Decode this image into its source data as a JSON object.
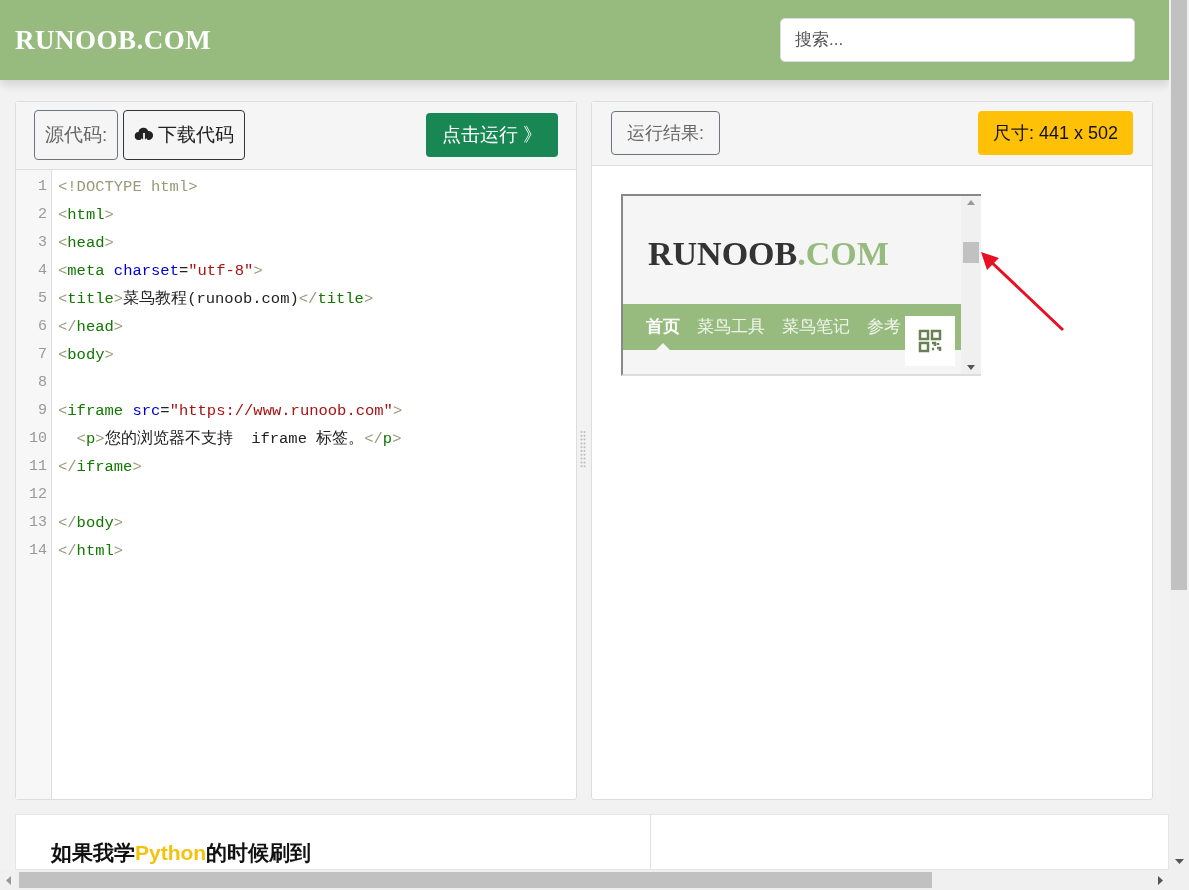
{
  "header": {
    "logo": "RUNOOB.COM",
    "search": {
      "placeholder": "搜索..."
    }
  },
  "editor_panel": {
    "label": "源代码:",
    "download_button": "下载代码",
    "run_button": "点击运行 》",
    "lines": [
      {
        "number": "1",
        "segments": [
          {
            "kind": "bracket",
            "text": "<!DOCTYPE html"
          },
          {
            "kind": "bracket",
            "text": ">"
          }
        ]
      },
      {
        "number": "2",
        "segments": [
          {
            "kind": "bracket",
            "text": "<"
          },
          {
            "kind": "tag",
            "text": "html"
          },
          {
            "kind": "bracket",
            "text": ">"
          }
        ]
      },
      {
        "number": "3",
        "segments": [
          {
            "kind": "bracket",
            "text": "<"
          },
          {
            "kind": "tag",
            "text": "head"
          },
          {
            "kind": "bracket",
            "text": ">"
          }
        ]
      },
      {
        "number": "4",
        "segments": [
          {
            "kind": "bracket",
            "text": "<"
          },
          {
            "kind": "tag",
            "text": "meta"
          },
          {
            "kind": "attr",
            "text": " charset"
          },
          {
            "kind": "plain",
            "text": "="
          },
          {
            "kind": "string",
            "text": "\"utf-8\""
          },
          {
            "kind": "bracket",
            "text": ">"
          }
        ]
      },
      {
        "number": "5",
        "segments": [
          {
            "kind": "bracket",
            "text": "<"
          },
          {
            "kind": "tag",
            "text": "title"
          },
          {
            "kind": "bracket",
            "text": ">"
          },
          {
            "kind": "plain",
            "text": "菜鸟教程(runoob.com)"
          },
          {
            "kind": "bracket",
            "text": "</"
          },
          {
            "kind": "tag",
            "text": "title"
          },
          {
            "kind": "bracket",
            "text": ">"
          }
        ]
      },
      {
        "number": "6",
        "segments": [
          {
            "kind": "bracket",
            "text": "</"
          },
          {
            "kind": "tag",
            "text": "head"
          },
          {
            "kind": "bracket",
            "text": ">"
          }
        ]
      },
      {
        "number": "7",
        "segments": [
          {
            "kind": "bracket",
            "text": "<"
          },
          {
            "kind": "tag",
            "text": "body"
          },
          {
            "kind": "bracket",
            "text": ">"
          }
        ]
      },
      {
        "number": "8"
      },
      {
        "number": "9",
        "segments": [
          {
            "kind": "bracket",
            "text": "<"
          },
          {
            "kind": "tag",
            "text": "iframe"
          },
          {
            "kind": "attr",
            "text": " src"
          },
          {
            "kind": "plain",
            "text": "="
          },
          {
            "kind": "string",
            "text": "\"https://www.runoob.com\""
          },
          {
            "kind": "bracket",
            "text": ">"
          }
        ]
      },
      {
        "number": "10",
        "segments": [
          {
            "kind": "bracket",
            "text": "  <"
          },
          {
            "kind": "tag",
            "text": "p"
          },
          {
            "kind": "bracket",
            "text": ">"
          },
          {
            "kind": "plain",
            "text": "您的浏览器不支持  iframe 标签。"
          },
          {
            "kind": "bracket",
            "text": "</"
          },
          {
            "kind": "tag",
            "text": "p"
          },
          {
            "kind": "bracket",
            "text": ">"
          }
        ]
      },
      {
        "number": "11",
        "segments": [
          {
            "kind": "bracket",
            "text": "</"
          },
          {
            "kind": "tag",
            "text": "iframe"
          },
          {
            "kind": "bracket",
            "text": ">"
          }
        ]
      },
      {
        "number": "12"
      },
      {
        "number": "13",
        "segments": [
          {
            "kind": "bracket",
            "text": "</"
          },
          {
            "kind": "tag",
            "text": "body"
          },
          {
            "kind": "bracket",
            "text": ">"
          }
        ]
      },
      {
        "number": "14",
        "segments": [
          {
            "kind": "bracket",
            "text": "</"
          },
          {
            "kind": "tag",
            "text": "html"
          },
          {
            "kind": "bracket",
            "text": ">"
          }
        ]
      }
    ]
  },
  "result_panel": {
    "label": "运行结果:",
    "size_badge": "尺寸: 441 x 502",
    "preview": {
      "logo_main": "RUNOOB",
      "logo_accent": ".COM",
      "nav": [
        {
          "label": "首页",
          "selected": true
        },
        {
          "label": "菜鸟工具",
          "selected": false
        },
        {
          "label": "菜鸟笔记",
          "selected": false
        },
        {
          "label": "参考",
          "selected": false
        }
      ]
    }
  },
  "bottom_banner": {
    "before": "如果我学",
    "highlight": "Python",
    "after": "的时候刷到"
  }
}
